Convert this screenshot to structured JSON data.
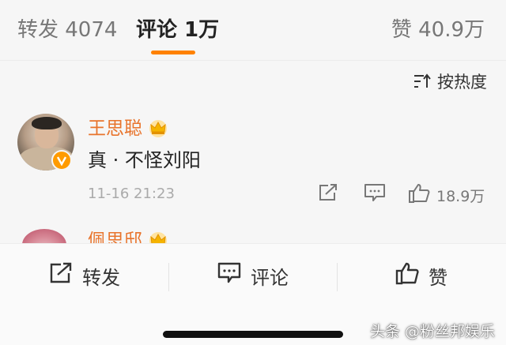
{
  "tabs": {
    "repost": "转发 4074",
    "comment": "评论 1万",
    "like": "赞 40.9万"
  },
  "sort": {
    "label": "按热度"
  },
  "comment": {
    "username": "王思聪",
    "text": "真 · 不怪刘阳",
    "time": "11-16 21:23",
    "like_count": "18.9万"
  },
  "next_comment": {
    "username": "佩思邸"
  },
  "bottom_bar": {
    "repost_label": "转发",
    "comment_label": "评论",
    "like_label": "赞"
  },
  "watermark": "头条 @粉丝邦娱乐",
  "colors": {
    "accent": "#ff8200",
    "username": "#e8742c",
    "crown": "#f5b400"
  }
}
